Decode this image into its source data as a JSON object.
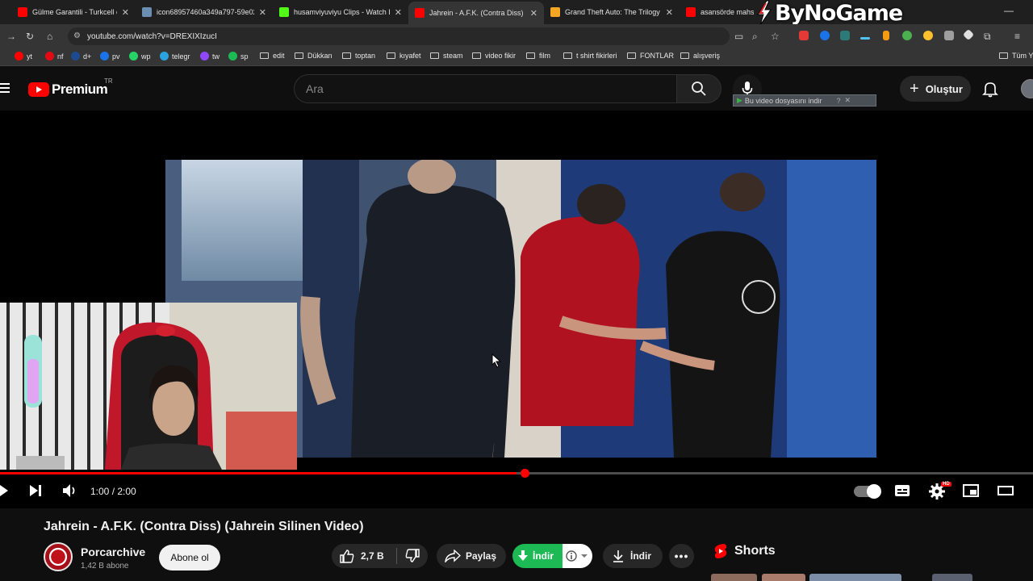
{
  "browser": {
    "tabs": [
      {
        "title": "Gülme Garantili - Turkcell çekm",
        "favicon_color": "#ff0000",
        "active": false
      },
      {
        "title": "icon68957460a349a797-59e02a",
        "favicon_color": "#6a8fb0",
        "active": false
      },
      {
        "title": "husamviyuviyu Clips - Watch Li",
        "favicon_color": "#53fc18",
        "active": false
      },
      {
        "title": "Jahrein - A.F.K. (Contra Diss) (Ja",
        "favicon_color": "#ff0000",
        "active": true
      },
      {
        "title": "Grand Theft Auto: The Trilogy -",
        "favicon_color": "#f5a623",
        "active": false
      },
      {
        "title": "asansörde mahsur",
        "favicon_color": "#ff0000",
        "active": false
      }
    ],
    "watermark": "ByNoGame",
    "url": "youtube.com/watch?v=DREXIXIzucI",
    "bookmarks": [
      {
        "label": "yt",
        "color": "#ff0000",
        "type": "site"
      },
      {
        "label": "nf",
        "color": "#e50914",
        "type": "site"
      },
      {
        "label": "d+",
        "color": "#1e4b8f",
        "type": "site"
      },
      {
        "label": "pv",
        "color": "#1a73e8",
        "type": "site"
      },
      {
        "label": "wp",
        "color": "#25d366",
        "type": "site"
      },
      {
        "label": "telegr",
        "color": "#2aa3e0",
        "type": "site"
      },
      {
        "label": "tw",
        "color": "#9146ff",
        "type": "site"
      },
      {
        "label": "sp",
        "color": "#1db954",
        "type": "site"
      },
      {
        "label": "edit",
        "type": "folder"
      },
      {
        "label": "Dükkan",
        "type": "folder"
      },
      {
        "label": "toptan",
        "type": "folder"
      },
      {
        "label": "kıyafet",
        "type": "folder"
      },
      {
        "label": "steam",
        "type": "folder"
      },
      {
        "label": "video fikir",
        "type": "folder"
      },
      {
        "label": "film",
        "type": "folder"
      },
      {
        "label": "t shirt fikirleri",
        "type": "folder"
      },
      {
        "label": "FONTLAR",
        "type": "folder"
      },
      {
        "label": "alışveriş",
        "type": "folder"
      }
    ],
    "all_bookmarks": "Tüm Ye"
  },
  "youtube": {
    "logo_text": "Premium",
    "region": "TR",
    "search_placeholder": "Ara",
    "download_hint": "Bu video dosyasını indir",
    "download_hint_extra": "?",
    "create_label": "Oluştur",
    "player": {
      "time": "1:00 / 2:00",
      "progress_fraction": 0.5
    },
    "video": {
      "title": "Jahrein - A.F.K. (Contra Diss) (Jahrein Silinen Video)",
      "channel": "Porcarchive",
      "subscribers": "1,42 B abone",
      "subscribe_label": "Abone ol",
      "likes": "2,7 B",
      "share_label": "Paylaş",
      "download_green_label": "İndir",
      "download_label": "İndir"
    },
    "shorts_label": "Shorts"
  },
  "colors": {
    "accent": "#ff0000",
    "bg": "#0f0f0f",
    "download_green": "#1db954"
  }
}
